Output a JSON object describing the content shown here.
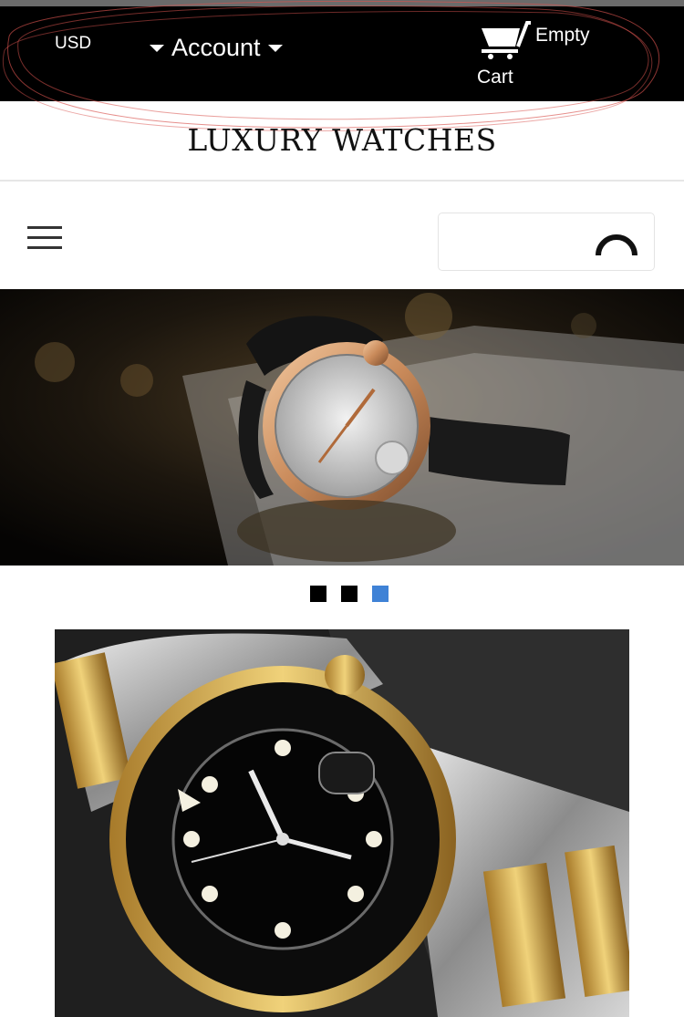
{
  "header": {
    "currency": "USD",
    "account_label": "Account",
    "cart_status": "Empty",
    "cart_label": "Cart"
  },
  "brand": {
    "title": "LUXURY WATCHES"
  },
  "search": {
    "value": "",
    "placeholder": ""
  },
  "carousel": {
    "slide_count": 3,
    "active_index": 2,
    "active_color": "#3f82d6"
  },
  "colors": {
    "topbar": "#000000",
    "annotation_scribble": "#d9534f"
  },
  "icons": {
    "cart": "cart-icon",
    "menu": "hamburger-menu-icon",
    "search": "loading-spinner-icon",
    "account": "caret-down-icon"
  }
}
